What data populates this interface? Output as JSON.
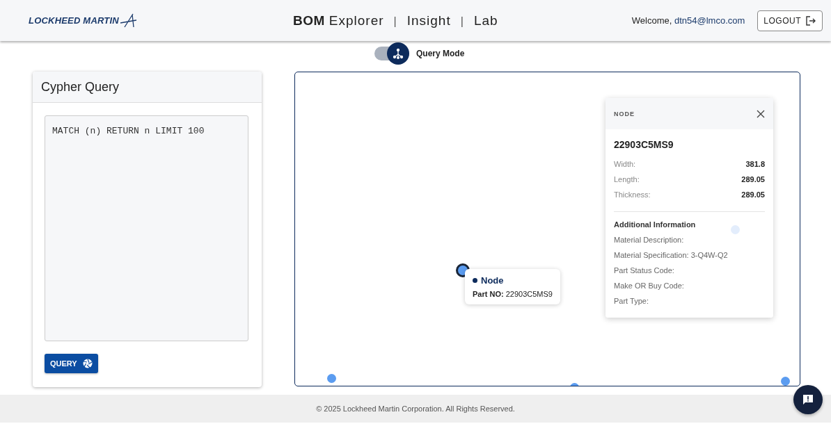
{
  "header": {
    "brand": "LOCKHEED MARTIN",
    "title_parts": [
      {
        "kind": "strong",
        "text": "BOM"
      },
      {
        "kind": "text",
        "text": "Explorer"
      },
      {
        "kind": "separator",
        "text": "|"
      },
      {
        "kind": "text",
        "text": "Insight"
      },
      {
        "kind": "separator",
        "text": "|"
      },
      {
        "kind": "text",
        "text": "Lab"
      }
    ],
    "welcome": "Welcome,",
    "user": "dtn54@lmco.com",
    "logout": "LOGOUT"
  },
  "mode_toggle": {
    "label": "Query Mode",
    "on": true
  },
  "query_panel": {
    "title": "Cypher Query",
    "query": "MATCH (n) RETURN n LIMIT 100",
    "button": "QUERY"
  },
  "graph": {
    "nodes": [
      {
        "kind": "hovered"
      },
      {
        "kind": "faded"
      },
      {
        "kind": "normal"
      },
      {
        "kind": "normal"
      },
      {
        "kind": "normal"
      }
    ],
    "tooltip": {
      "title": "Node",
      "text": "**Part NO:** 22903C5MS9"
    },
    "details": {
      "header": "NODE",
      "name": "22903C5MS9",
      "properties": [
        {
          "label": "Width:",
          "value": "381.8"
        },
        {
          "label": "Length:",
          "value": "289.05"
        },
        {
          "label": "Thickness:",
          "value": "289.05"
        }
      ],
      "section_title": "Additional Information",
      "fields": [
        "Material Description:",
        "Material Specification: 3-Q4W-Q2",
        "Part Status Code:",
        "Make OR Buy Code:",
        "Part Type:"
      ]
    }
  },
  "footer": "© 2025 Lockheed Martin Corporation. All Rights Reserved."
}
